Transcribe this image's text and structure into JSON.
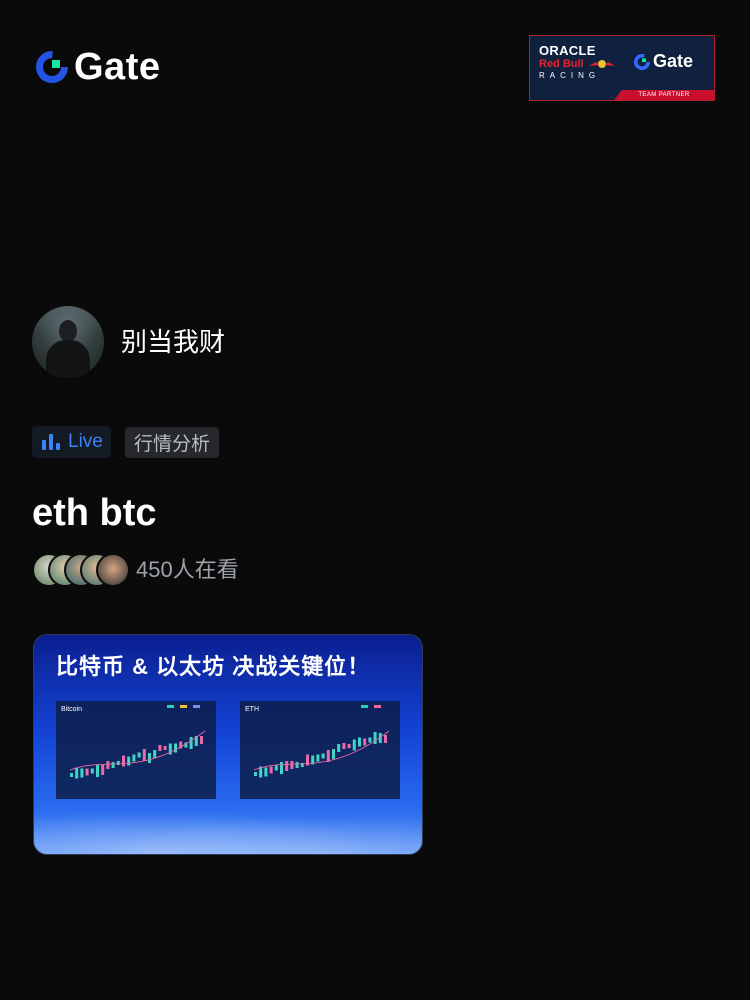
{
  "header": {
    "brand_name": "Gate",
    "partner_badge": {
      "oracle": "ORACLE",
      "redbull": "Red Bull",
      "racing": "RACING",
      "gate": "Gate",
      "team_partner": "TEAM PARTNER"
    }
  },
  "streamer": {
    "username": "别当我财"
  },
  "tags": {
    "live_label": "Live",
    "category": "行情分析"
  },
  "stream": {
    "title": "eth btc",
    "viewer_count": "450人在看"
  },
  "cover": {
    "headline": "比特币 & 以太坊 决战关键位！",
    "left_chart_label": "Bitcoin",
    "right_chart_label": "ETH"
  },
  "colors": {
    "background": "#0a0a0a",
    "accent_blue": "#3b82f6",
    "gate_green": "#17e6a1",
    "gate_blue": "#2354e6"
  }
}
